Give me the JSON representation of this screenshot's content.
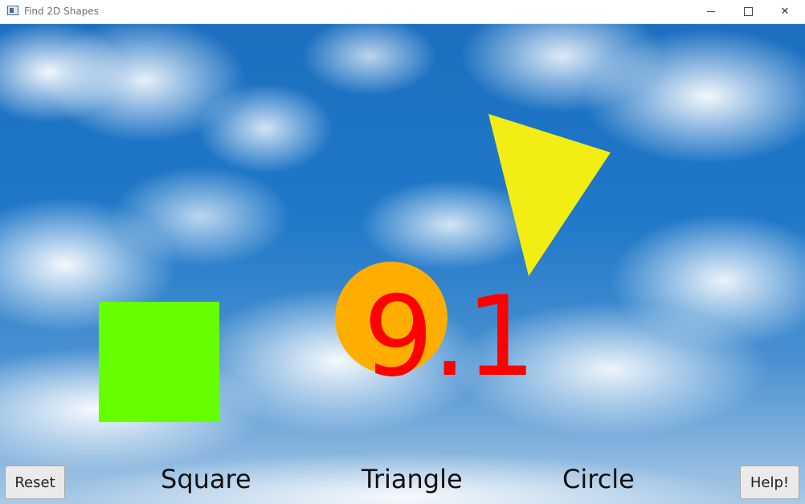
{
  "window": {
    "title": "Find 2D Shapes"
  },
  "game": {
    "number_display": "9.1",
    "number_color": "#ff0000",
    "shapes": {
      "square_color": "#66ff00",
      "circle_color": "#ffae00",
      "triangle_color": "#f2ee14"
    },
    "labels": {
      "square": "Square",
      "triangle": "Triangle",
      "circle": "Circle"
    },
    "buttons": {
      "reset": "Reset",
      "help": "Help!"
    },
    "background": "sky-with-clouds"
  },
  "icons": {
    "app": "app-window-icon",
    "minimize": "minimize-icon",
    "maximize": "maximize-icon",
    "close": "close-icon"
  }
}
